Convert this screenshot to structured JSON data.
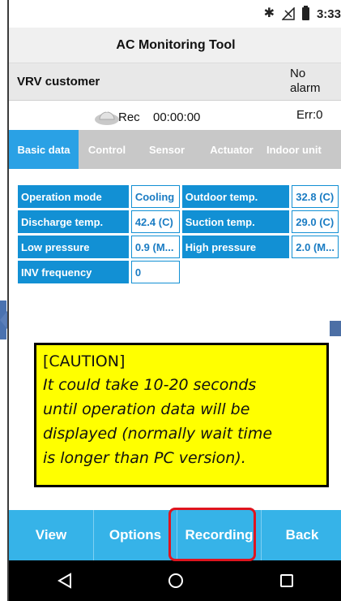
{
  "status_bar": {
    "time": "3:33",
    "icons": [
      "bluetooth-icon",
      "signal-icon",
      "battery-icon"
    ]
  },
  "app": {
    "title": "AC Monitoring Tool"
  },
  "customer": {
    "name": "VRV customer",
    "alarm": "No alarm"
  },
  "recording": {
    "label": "Rec",
    "time": "00:00:00",
    "error": "Err:0"
  },
  "tabs": [
    {
      "label": "Basic data",
      "active": true
    },
    {
      "label": "Control",
      "active": false
    },
    {
      "label": "Sensor",
      "active": false
    },
    {
      "label": "Actuator",
      "active": false
    },
    {
      "label": "Indoor unit",
      "active": false
    }
  ],
  "basic_data": [
    {
      "label1": "Operation mode",
      "value1": "Cooling",
      "label2": "Outdoor temp.",
      "value2": "32.8 (C)"
    },
    {
      "label1": "Discharge temp.",
      "value1": "42.4 (C)",
      "label2": "Suction temp.",
      "value2": "29.0 (C)"
    },
    {
      "label1": "Low pressure",
      "value1": "0.9 (M...",
      "label2": "High pressure",
      "value2": "2.0 (M..."
    },
    {
      "label1": "INV frequency",
      "value1": "0"
    }
  ],
  "caution": {
    "title": "[CAUTION]",
    "lines": [
      "It could take 10-20 seconds",
      "until operation data will be",
      "displayed (normally wait time",
      "is longer than PC version)."
    ]
  },
  "bottom_buttons": {
    "view": "View",
    "options": "Options",
    "recording": "Recording",
    "back": "Back"
  },
  "nav": [
    "back-icon",
    "home-icon",
    "recents-icon"
  ],
  "colors": {
    "accent": "#2aa1e5",
    "label_cell": "#1290d4",
    "bottom_bar": "#36b3e8",
    "caution_bg": "#ffff00",
    "highlight": "#e0141e"
  }
}
